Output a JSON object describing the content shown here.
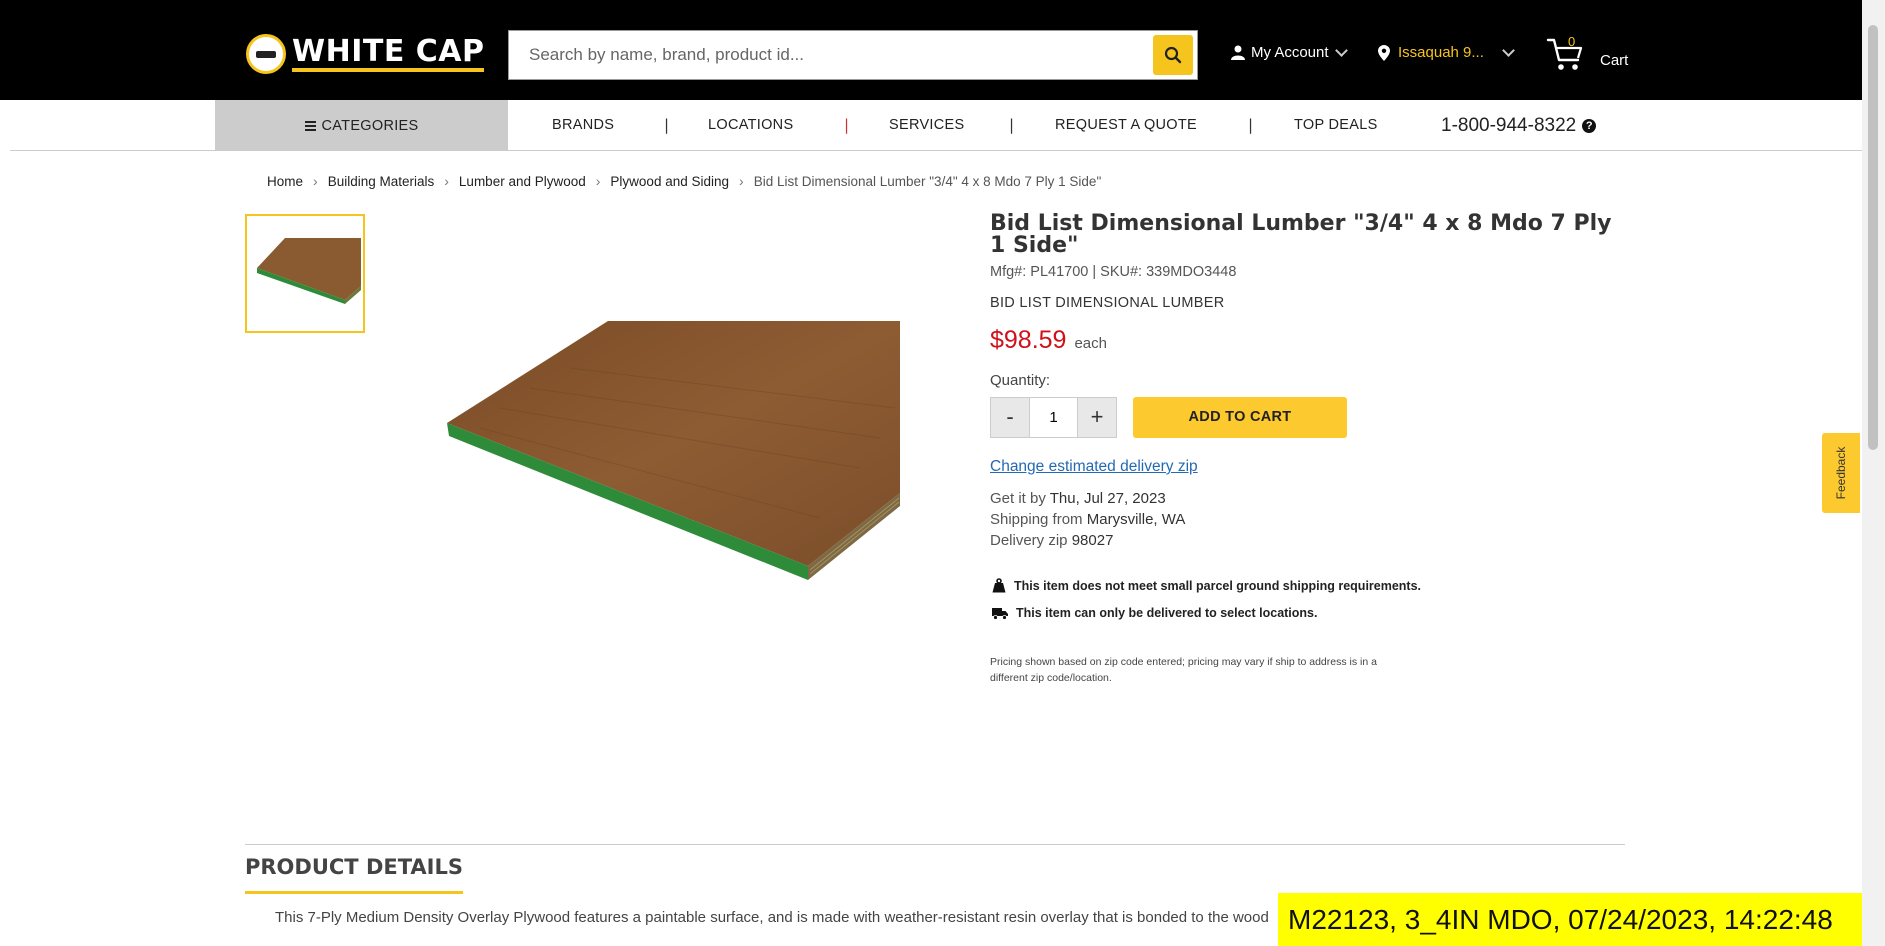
{
  "header": {
    "logo_text": "WHITE CAP",
    "search_placeholder": "Search by name, brand, product id...",
    "account_label": "My Account",
    "location_label": "Issaquah 9...",
    "cart_count": "0",
    "cart_label": "Cart"
  },
  "nav": {
    "categories": "CATEGORIES",
    "links": [
      "BRANDS",
      "LOCATIONS",
      "SERVICES",
      "REQUEST A QUOTE",
      "TOP DEALS"
    ],
    "separator": "|",
    "phone": "1-800-944-8322",
    "help": "?"
  },
  "breadcrumb": {
    "items": [
      "Home",
      "Building Materials",
      "Lumber and Plywood",
      "Plywood and Siding"
    ],
    "current": "Bid List Dimensional Lumber \"3/4\" 4 x 8 Mdo 7 Ply 1 Side\"",
    "separator": "›"
  },
  "product": {
    "title": "Bid List Dimensional Lumber \"3/4\" 4 x 8 Mdo 7 Ply 1 Side\"",
    "ids": "Mfg#: PL41700 | SKU#: 339MDO3448",
    "brand": "BID LIST DIMENSIONAL LUMBER",
    "price": "$98.59",
    "unit": "each",
    "quantity_label": "Quantity:",
    "quantity_value": "1",
    "minus": "-",
    "plus": "+",
    "add_to_cart": "ADD TO CART",
    "change_zip": "Change estimated delivery zip",
    "get_it_prefix": "Get it by",
    "get_it_date": "Thu, Jul 27, 2023",
    "shipping_prefix": "Shipping from",
    "shipping_from": "Marysville, WA",
    "zip_prefix": "Delivery zip",
    "zip": "98027",
    "notice_parcel": "This item does not meet small parcel ground shipping requirements.",
    "notice_delivery": "This item can only be delivered to select locations.",
    "disclaimer": "Pricing shown based on zip code entered; pricing may vary if ship to address is in a different zip code/location."
  },
  "details": {
    "heading": "PRODUCT DETAILS",
    "text": "This 7-Ply Medium Density Overlay Plywood features a paintable surface, and is made with weather-resistant resin overlay that is bonded to the wood"
  },
  "feedback": "Feedback",
  "overlay": "M22123, 3_4IN MDO, 07/24/2023, 14:22:48",
  "colors": {
    "accent": "#f5c51e",
    "price": "#d0111a",
    "link": "#2469b3",
    "board_top": "#8a5a30",
    "board_edge": "#2e8b3a"
  }
}
